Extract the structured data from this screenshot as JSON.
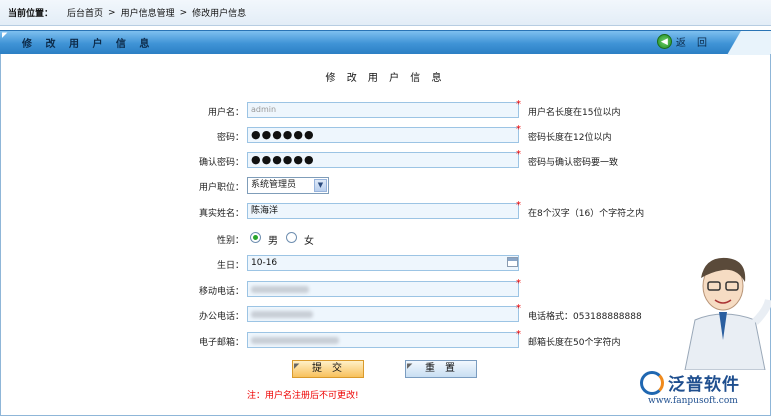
{
  "breadcrumb": {
    "label": "当前位置：",
    "items": [
      "后台首页",
      ">",
      "用户信息管理",
      ">",
      "修改用户信息"
    ]
  },
  "title_bar": {
    "title": "修 改 用 户 信 息",
    "return_label": "返 回"
  },
  "form": {
    "heading": "修 改 用 户 信 息",
    "username": {
      "label": "用户名：",
      "value": "admin",
      "hint": "用户名长度在15位以内"
    },
    "password": {
      "label": "密码：",
      "value": "●●●●●●",
      "hint": "密码长度在12位以内"
    },
    "confirm": {
      "label": "确认密码：",
      "value": "●●●●●●",
      "hint": "密码与确认密码要一致"
    },
    "position": {
      "label": "用户职位：",
      "selected": "系统管理员"
    },
    "realname": {
      "label": "真实姓名：",
      "value": "陈海洋",
      "hint": "在8个汉字（16）个字符之内"
    },
    "gender": {
      "label": "性别：",
      "male": "男",
      "female": "女",
      "selected": "男"
    },
    "birthday": {
      "label": "生日：",
      "value": "10-16"
    },
    "mobile": {
      "label": "移动电话："
    },
    "office": {
      "label": "办公电话：",
      "hint": "电话格式：053188888888"
    },
    "email": {
      "label": "电子邮箱：",
      "hint": "邮箱长度在50个字符内"
    },
    "required_mark": "*",
    "submit_label": "提交",
    "reset_label": "重置",
    "note": "注：用户名注册后不可更改!"
  },
  "brand": {
    "name": "泛普软件",
    "url": "www.fanpusoft.com"
  },
  "colors": {
    "title_bar": "#3f93d6",
    "required": "#e00000",
    "field_bg": "#eef6fd",
    "field_border": "#9cc4e4"
  }
}
